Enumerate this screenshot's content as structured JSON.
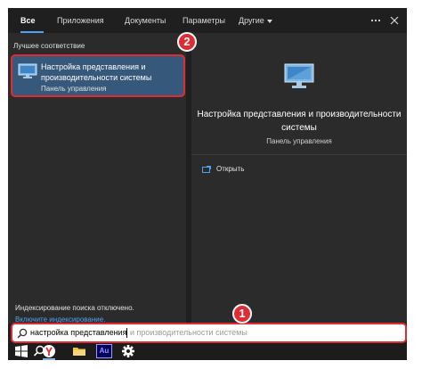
{
  "tabs": [
    {
      "label": "Все",
      "active": true
    },
    {
      "label": "Приложения"
    },
    {
      "label": "Документы"
    },
    {
      "label": "Параметры"
    },
    {
      "label": "Другие"
    }
  ],
  "left_panel": {
    "section_label": "Лучшее соответствие",
    "best_match": {
      "title": "Настройка представления и производительности системы",
      "subtitle": "Панель управления",
      "icon": "monitor-icon"
    },
    "indexing_message": "Индексирование поиска отключено.",
    "indexing_link": "Включите индексирование."
  },
  "right_panel": {
    "title": "Настройка представления и производительности системы",
    "subtitle": "Панель управления",
    "actions": [
      {
        "label": "Открыть",
        "icon": "open-icon"
      }
    ]
  },
  "search": {
    "typed": "настройка представления",
    "suggestion": " и производительности системы"
  },
  "badges": [
    "2",
    "1"
  ],
  "taskbar": {
    "items": [
      "start-icon",
      "search-icon",
      "yandex-browser-icon",
      "file-explorer-icon",
      "adobe-audition-icon",
      "settings-icon"
    ],
    "audition_label": "Au"
  },
  "colors": {
    "accent": "#4ea3f1",
    "selection": "#36587a",
    "highlight_border": "#e02b35",
    "panel_bg": "#2b2b2b"
  }
}
